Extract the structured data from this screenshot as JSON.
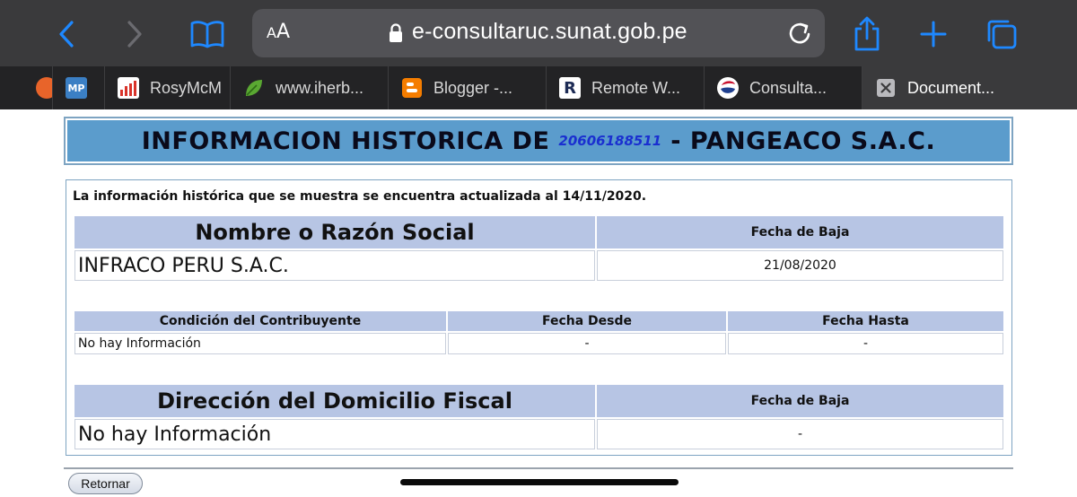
{
  "browser": {
    "text_size_label": "AA",
    "url": "e-consultaruc.sunat.gob.pe",
    "tabs": [
      {
        "favicon": "orange-circle-icon",
        "label": ""
      },
      {
        "favicon": "mp-logo-icon",
        "favicon_text": "MP",
        "label": ""
      },
      {
        "favicon": "bar-chart-icon",
        "label": "RosyMcM"
      },
      {
        "favicon": "leaf-icon",
        "label": "www.iherb..."
      },
      {
        "favicon": "blogger-icon",
        "label": "Blogger -..."
      },
      {
        "favicon": "remote-r-icon",
        "favicon_text": "R",
        "label": "Remote W..."
      },
      {
        "favicon": "sunat-icon",
        "label": "Consulta..."
      },
      {
        "favicon": "close-box-icon",
        "label": "Document..."
      }
    ]
  },
  "page": {
    "title_prefix": "INFORMACION HISTORICA DE",
    "ruc": "20606188511",
    "title_suffix": "- PANGEACO S.A.C.",
    "info_line": "La información histórica que se muestra se encuentra actualizada al 14/11/2020.",
    "razon_social_table": {
      "headers": [
        "Nombre o Razón Social",
        "Fecha de Baja"
      ],
      "row": [
        "INFRACO PERU S.A.C.",
        "21/08/2020"
      ]
    },
    "condicion_table": {
      "headers": [
        "Condición del Contribuyente",
        "Fecha Desde",
        "Fecha Hasta"
      ],
      "row": [
        "No hay Información",
        "-",
        "-"
      ]
    },
    "domicilio_table": {
      "headers": [
        "Dirección del Domicilio Fiscal",
        "Fecha de Baja"
      ],
      "row": [
        "No hay Información",
        "-"
      ]
    },
    "retornar_label": "Retornar"
  },
  "colors": {
    "title_bar": "#5b9ccc",
    "table_header": "#b7c5e4",
    "ruc_link": "#1a2fd0",
    "safari_blue": "#1e88ff"
  }
}
